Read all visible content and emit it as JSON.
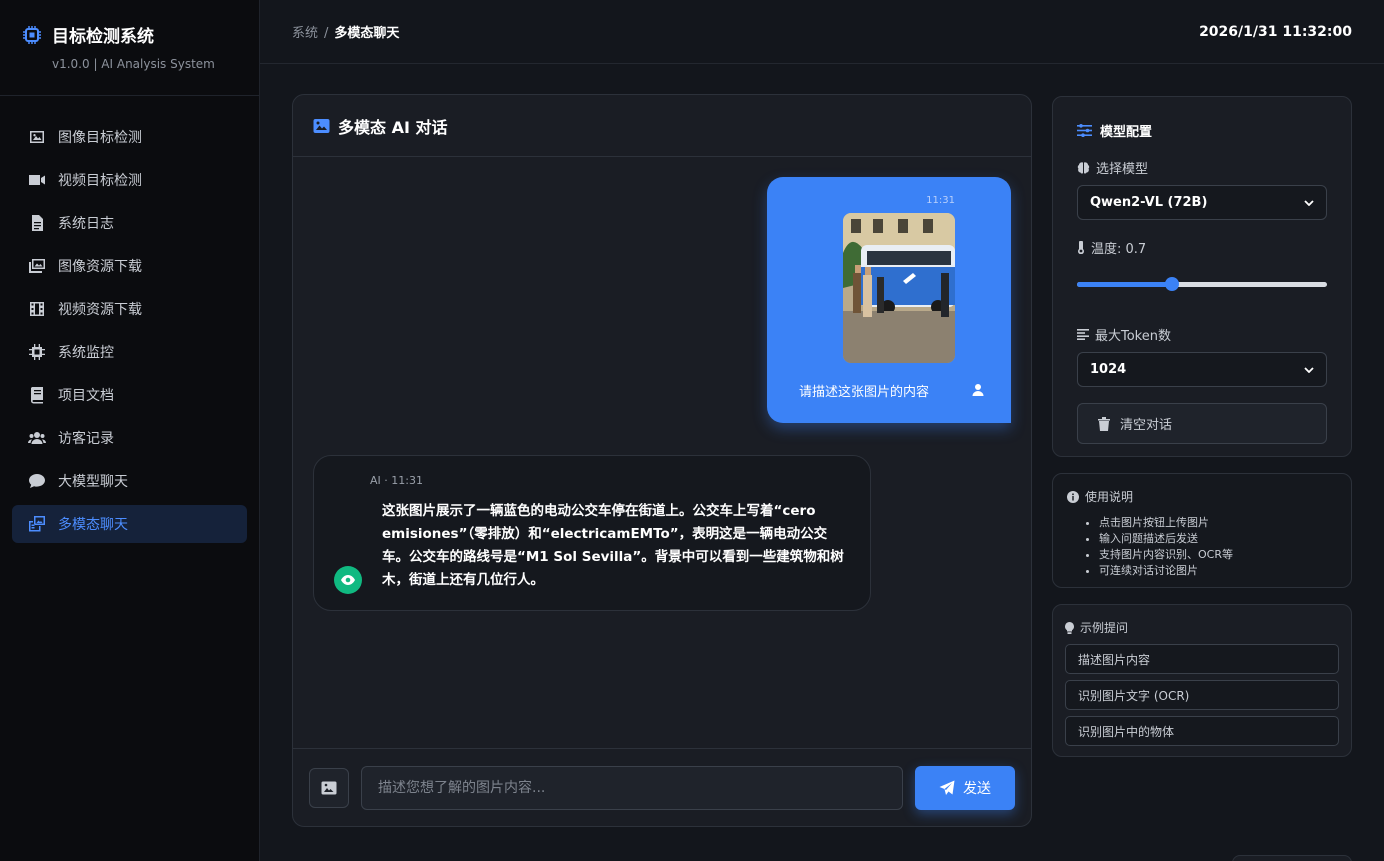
{
  "brand": {
    "title": "目标检测系统",
    "subtitle": "v1.0.0 | AI Analysis System"
  },
  "sidebar": {
    "items": [
      {
        "label": "图像目标检测",
        "icon": "image-icon"
      },
      {
        "label": "视频目标检测",
        "icon": "video-icon"
      },
      {
        "label": "系统日志",
        "icon": "file-icon"
      },
      {
        "label": "图像资源下载",
        "icon": "images-icon"
      },
      {
        "label": "视频资源下载",
        "icon": "film-icon"
      },
      {
        "label": "系统监控",
        "icon": "cpu-icon"
      },
      {
        "label": "项目文档",
        "icon": "book-icon"
      },
      {
        "label": "访客记录",
        "icon": "users-icon"
      },
      {
        "label": "大模型聊天",
        "icon": "comment-icon"
      },
      {
        "label": "多模态聊天",
        "icon": "photo-video-icon",
        "active": true
      }
    ]
  },
  "topbar": {
    "breadcrumb_root": "系统",
    "breadcrumb_sep": "/",
    "breadcrumb_current": "多模态聊天",
    "clock": "2026/1/31 11:32:00"
  },
  "chat": {
    "title": "多模态 AI 对话",
    "user_message": {
      "time": "11:31",
      "text": "请描述这张图片的内容"
    },
    "ai_message": {
      "meta": "AI · 11:31",
      "text": "这张图片展示了一辆蓝色的电动公交车停在街道上。公交车上写着“cero emisiones”（零排放）和“electricamEMTo”，表明这是一辆电动公交车。公交车的路线号是“M1 Sol Sevilla”。背景中可以看到一些建筑物和树木，街道上还有几位行人。"
    },
    "input_placeholder": "描述您想了解的图片内容...",
    "send_label": "发送"
  },
  "config": {
    "title": "模型配置",
    "model_label": "选择模型",
    "model_value": "Qwen2-VL (72B)",
    "temperature_label": "温度: 0.7",
    "temperature_fraction": 0.38,
    "tokens_label": "最大Token数",
    "tokens_value": "1024",
    "clear_label": "清空对话"
  },
  "help": {
    "title": "使用说明",
    "items": [
      "点击图片按钮上传图片",
      "输入问题描述后发送",
      "支持图片内容识别、OCR等",
      "可连续对话讨论图片"
    ]
  },
  "examples": {
    "title": "示例提问",
    "items": [
      "描述图片内容",
      "识别图片文字 (OCR)",
      "识别图片中的物体"
    ]
  },
  "colors": {
    "accent": "#3b82f6",
    "ai_avatar": "#10b981",
    "bg": "#13161c"
  }
}
